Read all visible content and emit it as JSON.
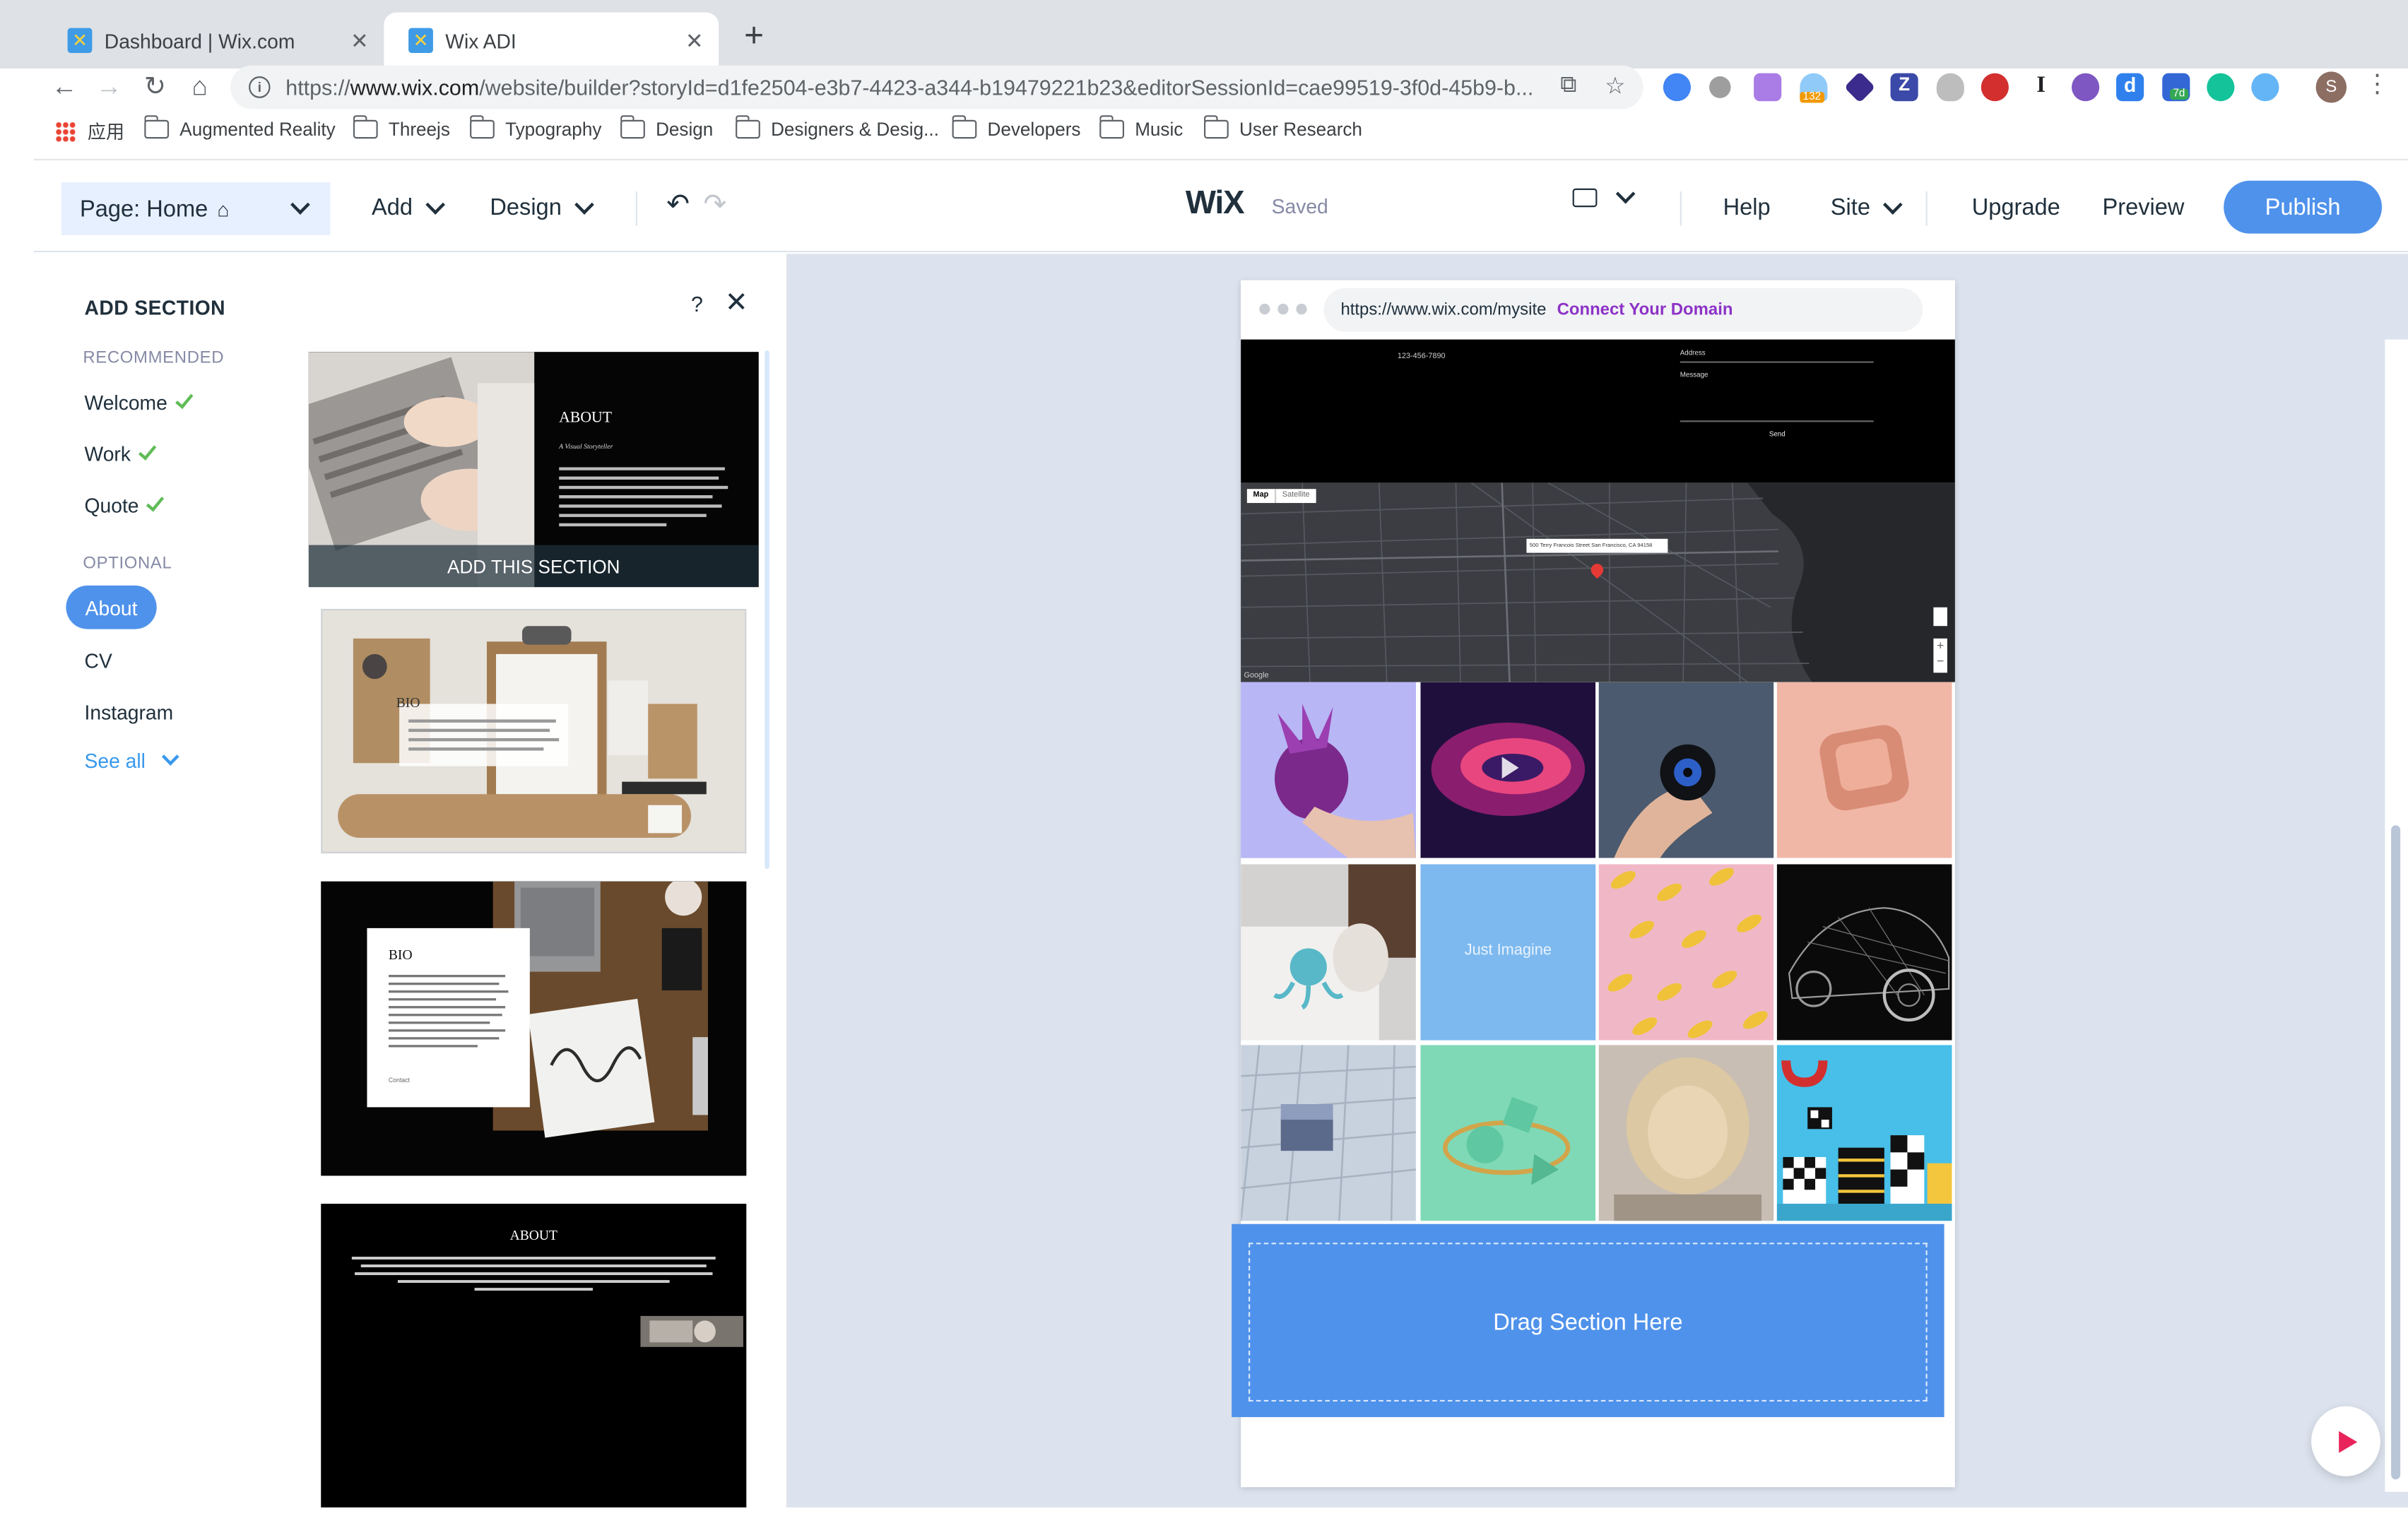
{
  "browser": {
    "tabs": [
      {
        "title": "Dashboard | Wix.com",
        "active": false
      },
      {
        "title": "Wix ADI",
        "active": true
      }
    ],
    "url_prefix": "https://",
    "url_host": "www.wix.com",
    "url_path": "/website/builder?storyId=d1fe2504-e3b7-4423-a344-b19479221b23&editorSessionId=cae99519-3f0d-45b9-b...",
    "extension_badges": {
      "badge_a": "132",
      "badge_b": "7d"
    },
    "profile_initial": "S",
    "bookmarks": [
      "应用",
      "Augmented Reality",
      "Threejs",
      "Typography",
      "Design",
      "Designers & Desig...",
      "Developers",
      "Music",
      "User Research"
    ]
  },
  "editor": {
    "page_label": "Page: Home",
    "add": "Add",
    "design": "Design",
    "logo": "WiX",
    "saved": "Saved",
    "help": "Help",
    "site": "Site",
    "upgrade": "Upgrade",
    "preview": "Preview",
    "publish": "Publish",
    "brand_color": "#4f92eb"
  },
  "panel": {
    "title": "ADD SECTION",
    "help": "?",
    "recommended_heading": "RECOMMENDED",
    "recommended": [
      "Welcome",
      "Work",
      "Quote"
    ],
    "optional_heading": "OPTIONAL",
    "optional": [
      "About",
      "CV",
      "Instagram"
    ],
    "selected": "About",
    "see_all": "See all",
    "thumbnails": [
      {
        "heading": "ABOUT",
        "subtitle": "A Visual Storyteller",
        "overlay": "ADD THIS SECTION"
      },
      {
        "heading": "BIO"
      },
      {
        "heading": "BIO",
        "link": "Contact"
      },
      {
        "heading": "ABOUT"
      }
    ]
  },
  "site_preview": {
    "url": "https://www.wix.com/mysite",
    "connect": "Connect Your Domain",
    "contact": {
      "phone": "123-456-7890",
      "address_label": "Address",
      "message_label": "Message",
      "send": "Send"
    },
    "map": {
      "tab_map": "Map",
      "tab_satellite": "Satellite",
      "pin_label": "500 Terry Francois Street San Francisco, CA 94158",
      "credit": "Google"
    },
    "gallery_caption": "Just Imagine",
    "drag_text": "Drag Section Here"
  }
}
